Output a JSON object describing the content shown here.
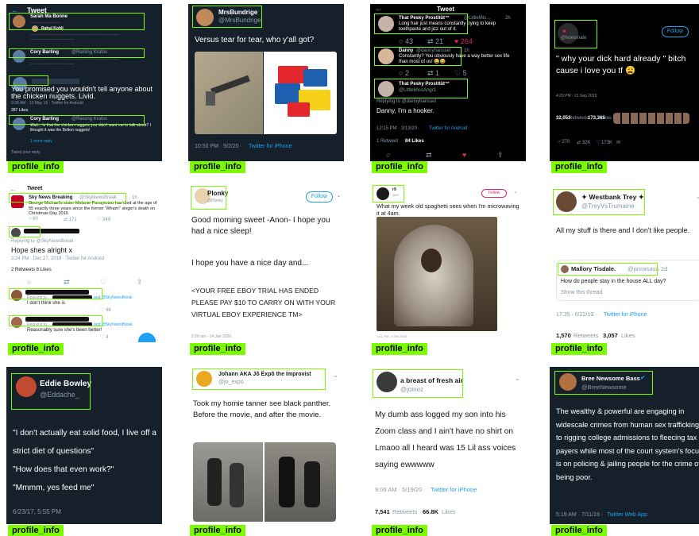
{
  "tag_label": "profile_info",
  "cells": {
    "c1": {
      "header": "Tweet",
      "u1_name": "Sarah Ma Bonne",
      "u2_name": "Rahul Kohli",
      "u3_name": "Cory Barling",
      "u3_reply": "@Raising Kratos",
      "u4_name": "Cory Barling",
      "main_text": "You promised you wouldn't tell anyone about the chicken nuggets. Livid.",
      "time": "9:38 AM · 13 May 19 · Twitter for Android",
      "likes": "287 Likes",
      "u5_name": "Cory Barling",
      "u5_reply": "@Raising Kratos",
      "reply_text": "Wait... Is that the chicken nuggets you didn't want me to talk about? I thought it was the Bolton nuggets!",
      "show_more": "1 more reply",
      "footer": "Tweet your reply"
    },
    "c2": {
      "name": "MrsBundrige",
      "handle": "@MrsBundrige",
      "text": "Versus tear for tear, who y'all got?",
      "time": "10:50 PM · 9/2/20 · ",
      "client": "Twitter for iPhone"
    },
    "c3": {
      "header": "Tweet",
      "u1_name": "That Pesky Prostitüt™",
      "u1_handle": "@LittleMis...",
      "u1_age": "2h",
      "u1_text": "Long hair just means constantly trying to keep toothpaste and jizz out of it.",
      "u1_counts": [
        "43",
        "21",
        "264"
      ],
      "u2_name": "Danny",
      "u2_handle": "@dannyhanssel",
      "u2_age": "1h",
      "u2_text": "Constantly? You obviously have a way better sex life than most of us! 😂😂",
      "u2_counts": [
        "2",
        "1",
        "5"
      ],
      "u3_name": "That Pesky Prostitüt™",
      "u3_handle": "@LittleMissAngr1",
      "reply_to": "Replying to @dannyhanssel",
      "u3_text": "Danny, I'm a hooker.",
      "time": "12:15 PM · 3/13/20 · ",
      "client": "Twitter for Android",
      "retweets": "1 Retweet",
      "likes": "84 Likes"
    },
    "c4": {
      "follow": "Follow",
      "handle": "@hoesmate",
      "text": "\" why your dick hard already \" bitch cause i love you tf 😩",
      "time": "4:20 PM - 21 Sep 2019",
      "retweets_count": "32,053",
      "retweets_label": "Retweets",
      "likes_count": "173,365",
      "likes_label": "Likes",
      "counts": [
        "270",
        "32K",
        "173K"
      ]
    },
    "c5": {
      "header": "Tweet",
      "name": "Sky News Breaking",
      "handle": "@SkyNewsBreak",
      "age": "1h",
      "text": "George Michael's sister Melanie Panayiotou has died at the age of 55 exactly three years since the former 'Wham!' singer's death on Christmas Day 2016",
      "counts": [
        "60",
        "171",
        "349"
      ],
      "reply_to": "Replying to @SkyNewsBreak",
      "main_text": "Hope shes alright x",
      "time": "3:24 PM · Dec 27, 2019 · Twitter for Android",
      "stats": "2 Retweets   8 Likes",
      "r1_reply": "Replying to",
      "r1_and": "and @SkyNewsBreak",
      "r1_text": "I don't think she is",
      "r1_likes": "46",
      "r2_reply": "Replying to",
      "r2_and": "and @SkyNewsBreak",
      "r2_text": "Reasonably sure she's been better!",
      "r2_likes": "4"
    },
    "c6": {
      "name": "Plonky",
      "handle": "@Plonky",
      "follow": "Follow",
      "p1": "Good morning sweet -Anon- I hope you had a nice sleep!",
      "p2": "I hope you have a nice day and...",
      "p3": "<YOUR FREE EBOY TRIAL HAS ENDED PLEASE PAY $10 TO CARRY ON WITH YOUR VIRTUAL EBOY EXPERIENCE TM>",
      "time": "2:20 am - 14 Jan 2020"
    },
    "c7": {
      "name": "r9",
      "handle": "@r9",
      "follow": "Follow",
      "text": "What my week old spaghetti sees when I'm microwaving it at 4am.",
      "time": "1:41 PM - 9 Oct 2018"
    },
    "c8": {
      "name": "Westbank Trey",
      "handle": "@TreyVsTrumaine",
      "text": "All my stuff is there and I don't like people.",
      "q_name": "Mallory Tisdale.",
      "q_handle": "@prinxsass",
      "q_age": "2d",
      "q_text": "How do people stay in the house ALL day?",
      "q_show": "Show this thread",
      "time": "17:35 · 6/22/19 · ",
      "client": "Twitter for iPhone",
      "retweets_count": "1,570",
      "retweets_label": "Retweets",
      "likes_count": "3,057",
      "likes_label": "Likes"
    },
    "c9": {
      "name": "Eddie Bowley",
      "handle": "@Eddache_",
      "l1": "\"I don't actually eat solid food, I live off a strict diet of questions\"",
      "l2": "\"How does that even work?\"",
      "l3": "\"Mmmm, yes feed me\"",
      "time": "6/23/17, 5:55 PM"
    },
    "c10": {
      "name": "Johann AKA Jõ Ëxpõ the Improvist",
      "handle": "@jo_expo",
      "text": "Took my homie tanner see black panther. Before the movie, and after the movie."
    },
    "c11": {
      "name": "a breast of fresh air",
      "handle": "@joinez",
      "text": "My dumb ass logged my son into his Zoom class and I ain't have no shirt on Lmaoo all I heard was 15 Lil ass voices saying ewwwww",
      "time": "9:06 AM · 5/19/20 · ",
      "client": "Twitter for iPhone",
      "retweets_count": "7,541",
      "retweets_label": "Retweets",
      "likes_count": "66.8K",
      "likes_label": "Likes"
    },
    "c12": {
      "name": "Bree Newsome Bass",
      "handle": "@BreeNewsome",
      "text": "The wealthy & powerful are engaging in widescale crimes from human sex trafficking to rigging college admissions to fleecing tax payers while most of the court system's focus is on policing & jailing people for the crime of being poor.",
      "time": "5:19 AM · 7/11/19 · ",
      "client": "Twitter Web App"
    }
  },
  "colors": {
    "highlight": "#7cfc00",
    "twitter_blue": "#1da1f2",
    "dark_bg": "#15202b",
    "like_red": "#e0245e"
  }
}
